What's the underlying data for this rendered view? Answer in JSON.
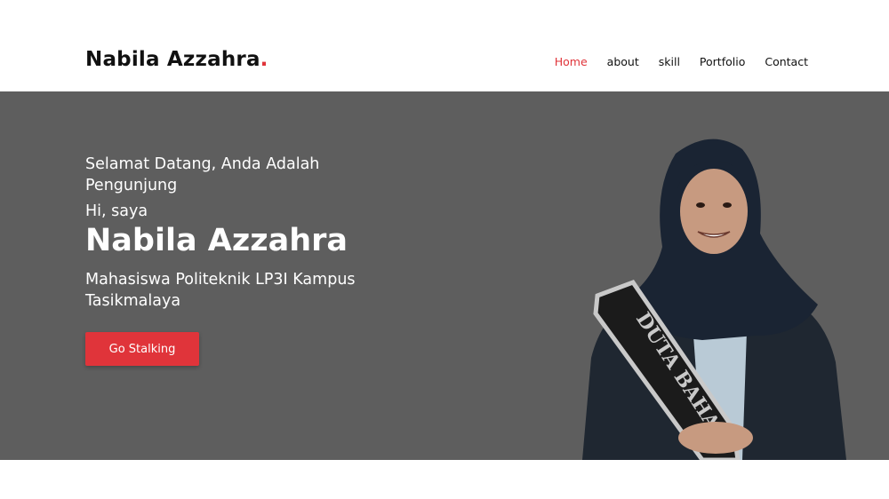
{
  "brand": {
    "name": "Nabila Azzahra",
    "dot": ".",
    "accent": "#e0343a"
  },
  "nav": {
    "items": [
      {
        "label": "Home",
        "active": true
      },
      {
        "label": "about",
        "active": false
      },
      {
        "label": "skill",
        "active": false
      },
      {
        "label": "Portfolio",
        "active": false
      },
      {
        "label": "Contact",
        "active": false
      }
    ]
  },
  "hero": {
    "welcome": "Selamat Datang, Anda Adalah Pengunjung",
    "greeting": "Hi, saya",
    "name": "Nabila Azzahra",
    "role": "Mahasiswa Politeknik LP3I Kampus Tasikmalaya",
    "cta_label": "Go Stalking",
    "background": "#5e5e5e",
    "sash_text": "DUTA BAHAS"
  }
}
